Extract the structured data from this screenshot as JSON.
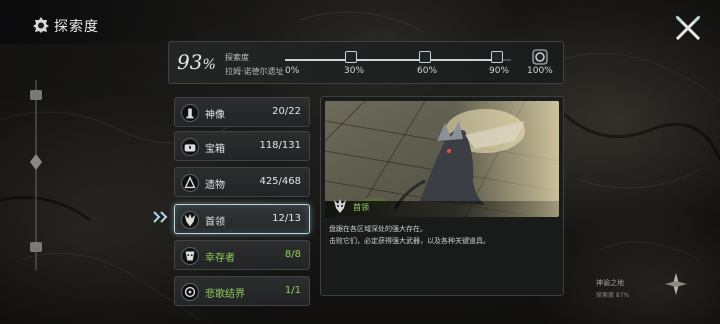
{
  "header": {
    "title": "探索度",
    "icon": "gear-icon"
  },
  "progress": {
    "percent_value": "93",
    "percent_sign": "%",
    "fraction": 0.93,
    "label": "探索度",
    "region": "拉姆·诺德尔遗址",
    "milestones": [
      {
        "label": "0%",
        "value": 0.0,
        "checked": false
      },
      {
        "label": "30%",
        "value": 0.3,
        "checked": true
      },
      {
        "label": "60%",
        "value": 0.6,
        "checked": true
      },
      {
        "label": "90%",
        "value": 0.9,
        "checked": true
      },
      {
        "label": "100%",
        "value": 1.0,
        "checked": false,
        "icon": "reward-icon"
      }
    ]
  },
  "categories": [
    {
      "name": "神像",
      "count": "20/22",
      "icon": "statue-icon",
      "state": "normal"
    },
    {
      "name": "宝箱",
      "count": "118/131",
      "icon": "chest-icon",
      "state": "normal"
    },
    {
      "name": "遗物",
      "count": "425/468",
      "icon": "relic-icon",
      "state": "normal"
    },
    {
      "name": "首领",
      "count": "12/13",
      "icon": "boss-icon",
      "state": "active"
    },
    {
      "name": "幸存者",
      "count": "8/8",
      "icon": "survivor-icon",
      "state": "done"
    },
    {
      "name": "悲歌结界",
      "count": "1/1",
      "icon": "barrier-icon",
      "state": "done"
    }
  ],
  "detail": {
    "caption": "首领",
    "description_line1": "盘踞在各区域深处的强大存在。",
    "description_line2": "击败它们，必定获得强大武器，以及各种关键道具。"
  },
  "location": {
    "name": "神谕之地",
    "sub": "探索度 87%"
  },
  "colors": {
    "accent": "#b9d4d8",
    "complete": "#8fcf5a",
    "panel": "#242627"
  }
}
